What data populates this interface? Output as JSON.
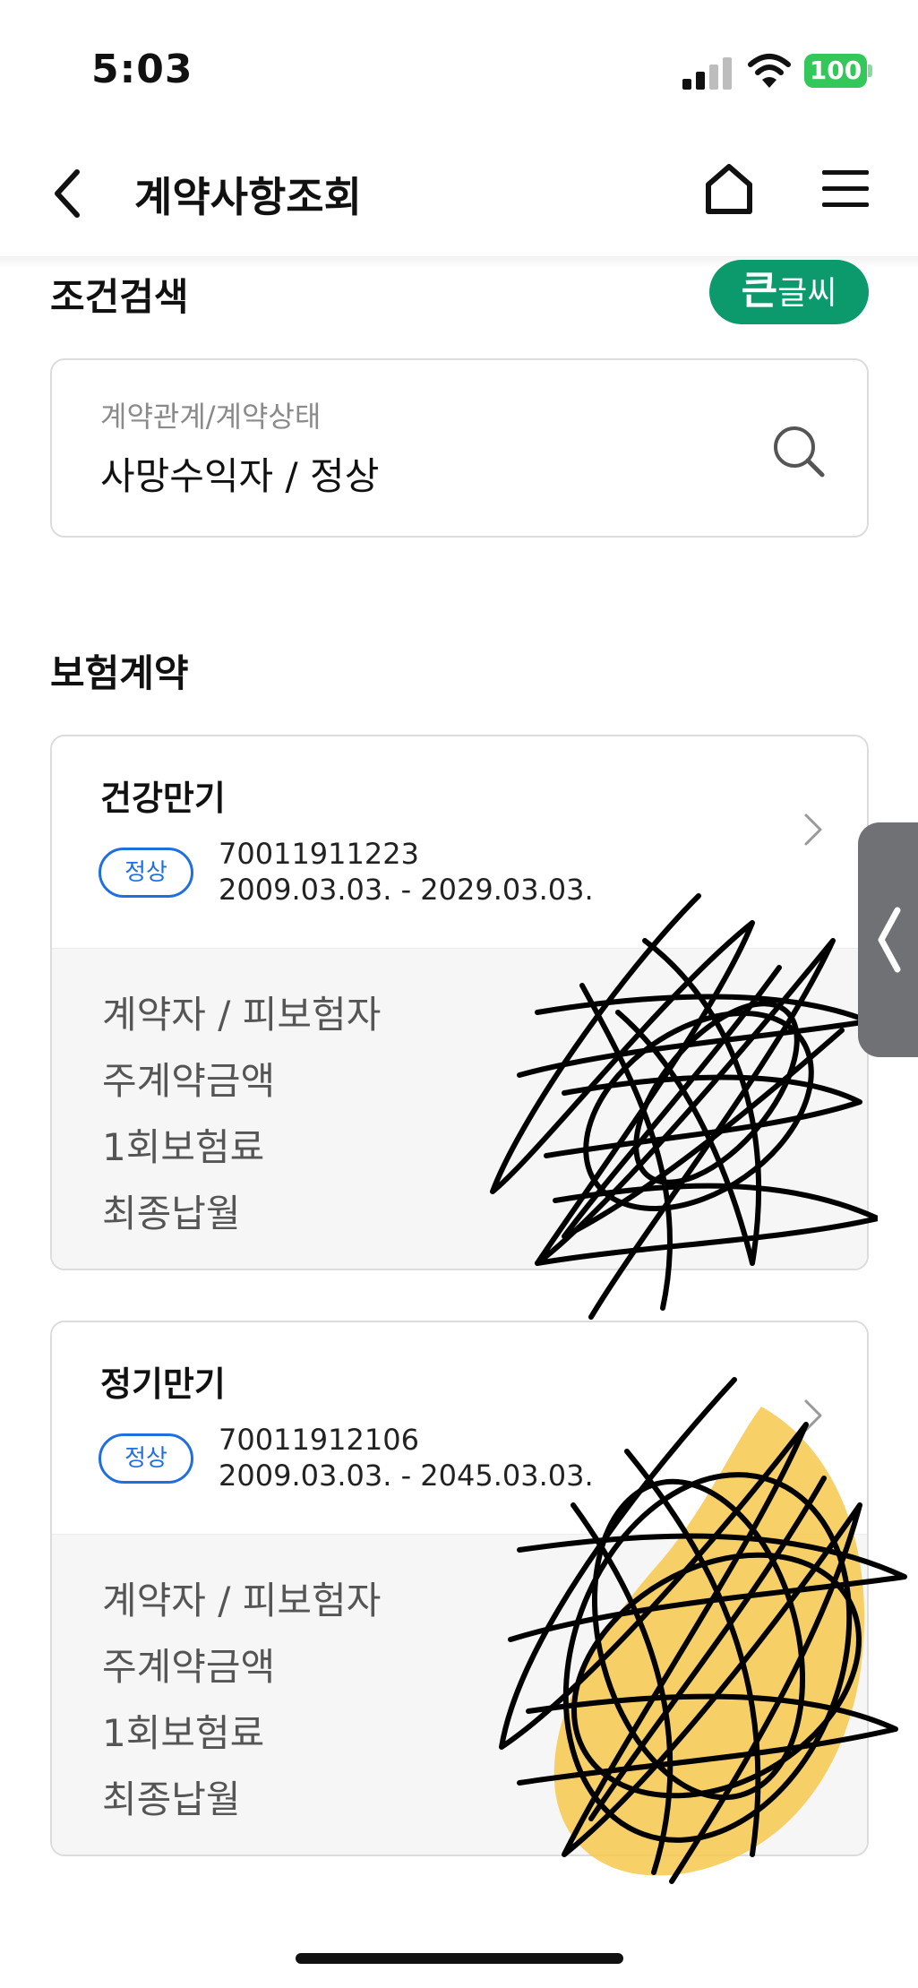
{
  "status_bar": {
    "time": "5:03",
    "battery": "100",
    "icons": [
      "signal-icon",
      "wifi-icon",
      "battery-icon"
    ]
  },
  "nav": {
    "title": "계약사항조회",
    "icons": [
      "back-icon",
      "home-icon",
      "menu-icon"
    ]
  },
  "condition": {
    "section_title": "조건검색",
    "big_font_button": {
      "big": "큰",
      "small": "글씨"
    },
    "search": {
      "label": "계약관계/계약상태",
      "value": "사망수익자 / 정상",
      "icon": "search-icon"
    }
  },
  "contracts": {
    "section_title": "보험계약",
    "items": [
      {
        "name": "건강만기",
        "status": "정상",
        "number": "70011911223",
        "period": "2009.03.03. - 2029.03.03.",
        "labels": [
          "계약자 / 피보험자",
          "주계약금액",
          "1회보험료",
          "최종납월"
        ]
      },
      {
        "name": "정기만기",
        "status": "정상",
        "number": "70011912106",
        "period": "2009.03.03. - 2045.03.03.",
        "labels": [
          "계약자 / 피보험자",
          "주계약금액",
          "1회보험료",
          "최종납월"
        ]
      }
    ]
  },
  "colors": {
    "accent_green": "#0c9a6c",
    "badge_blue": "#1f6fe0",
    "battery_green": "#34c759",
    "side_tab": "#6f7175"
  }
}
